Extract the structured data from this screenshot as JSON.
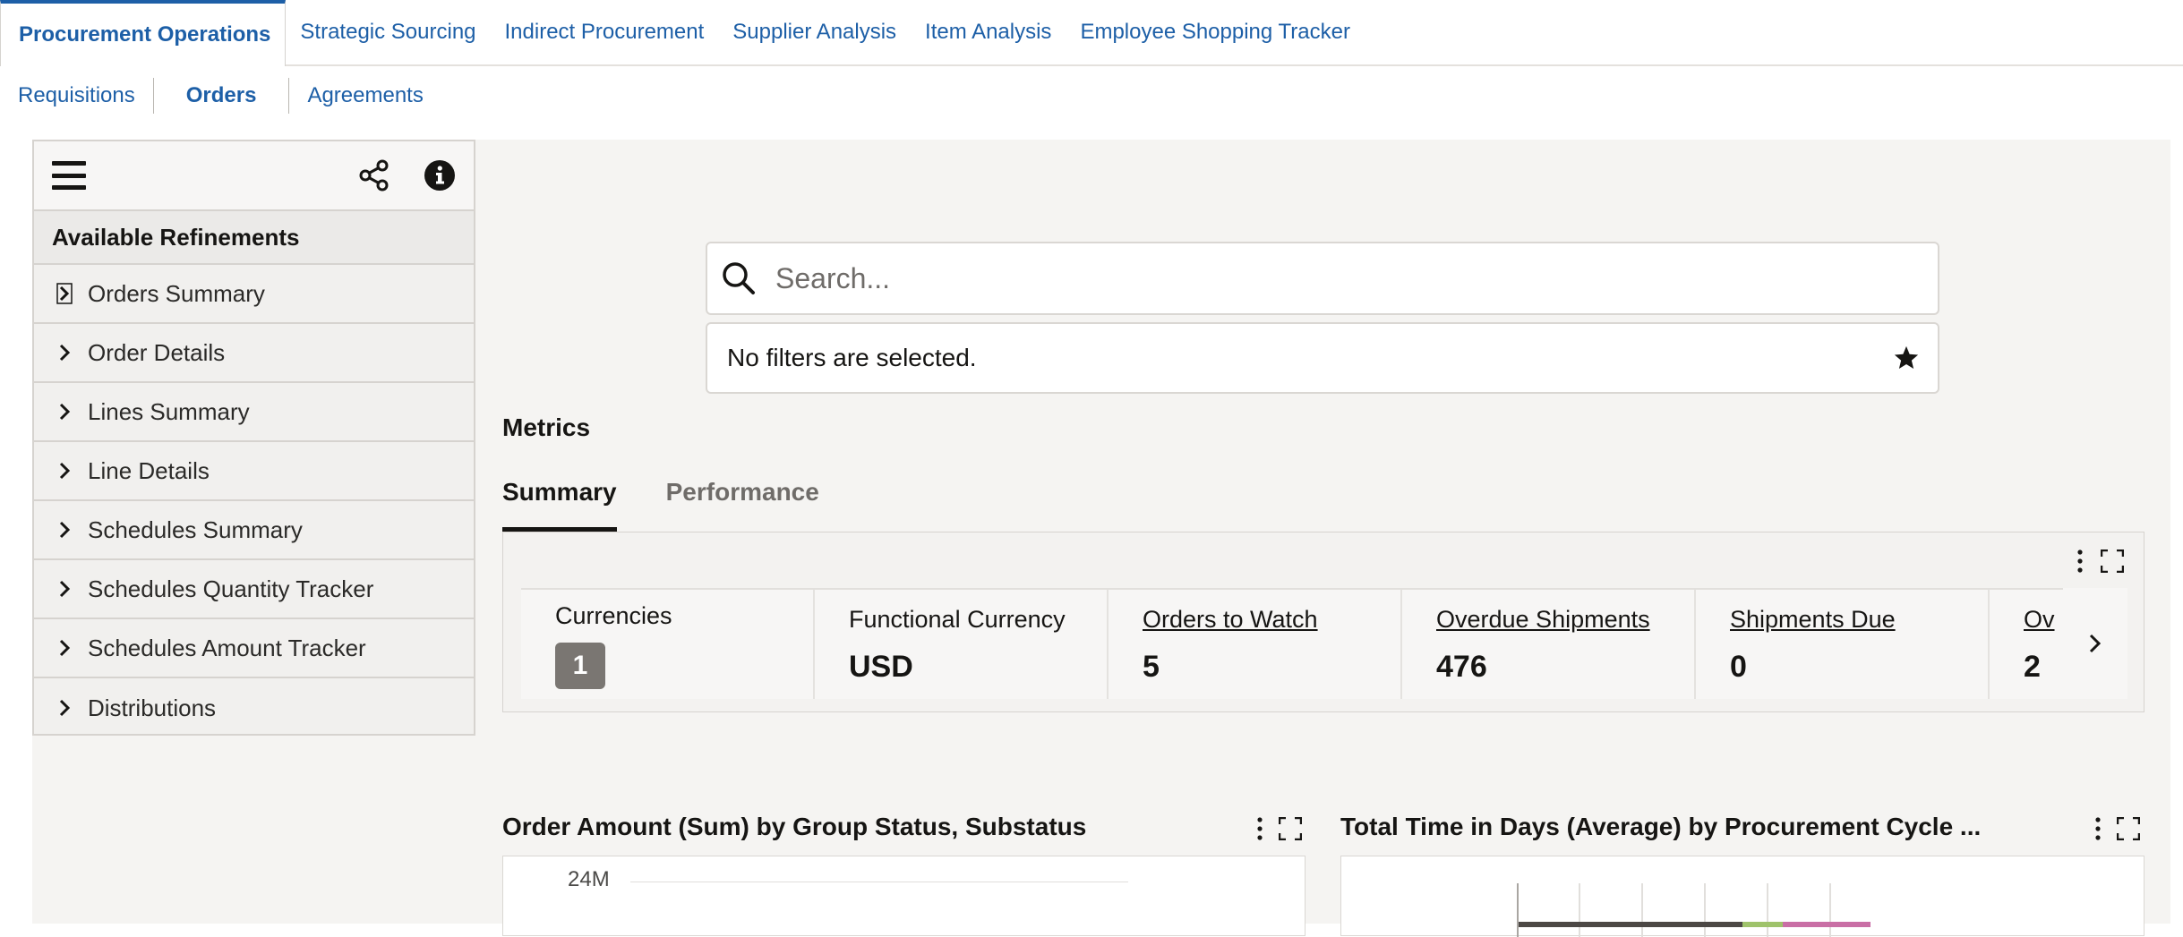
{
  "top_tabs": [
    "Procurement Operations",
    "Strategic Sourcing",
    "Indirect Procurement",
    "Supplier Analysis",
    "Item Analysis",
    "Employee Shopping Tracker"
  ],
  "sub_tabs": [
    "Requisitions",
    "Orders",
    "Agreements"
  ],
  "refinements": {
    "heading": "Available Refinements",
    "items": [
      "Orders Summary",
      "Order Details",
      "Lines Summary",
      "Line Details",
      "Schedules Summary",
      "Schedules Quantity Tracker",
      "Schedules Amount Tracker",
      "Distributions"
    ]
  },
  "search": {
    "placeholder": "Search..."
  },
  "filters": {
    "text": "No filters are selected."
  },
  "metrics": {
    "title": "Metrics",
    "tabs": [
      "Summary",
      "Performance"
    ],
    "tiles": [
      {
        "label": "Currencies",
        "value": "1"
      },
      {
        "label": "Functional Currency",
        "value": "USD"
      },
      {
        "label": "Orders to Watch",
        "value": "5"
      },
      {
        "label": "Overdue Shipments",
        "value": "476"
      },
      {
        "label": "Shipments Due",
        "value": "0"
      },
      {
        "label": "Ov",
        "value": "2"
      }
    ]
  },
  "charts": {
    "left_title": "Order Amount (Sum) by Group Status, Substatus",
    "left_axis_tick": "24M",
    "right_title": "Total Time in Days (Average) by Procurement Cycle ..."
  },
  "colors": {
    "link": "#1d5fa7",
    "panel_bg": "#f1f0ee",
    "content_bg": "#f5f4f2"
  },
  "icons": [
    "hamburger-icon",
    "share-icon",
    "info-icon",
    "chevron-right-icon",
    "search-icon",
    "star-icon",
    "more-vertical-icon",
    "expand-icon"
  ]
}
